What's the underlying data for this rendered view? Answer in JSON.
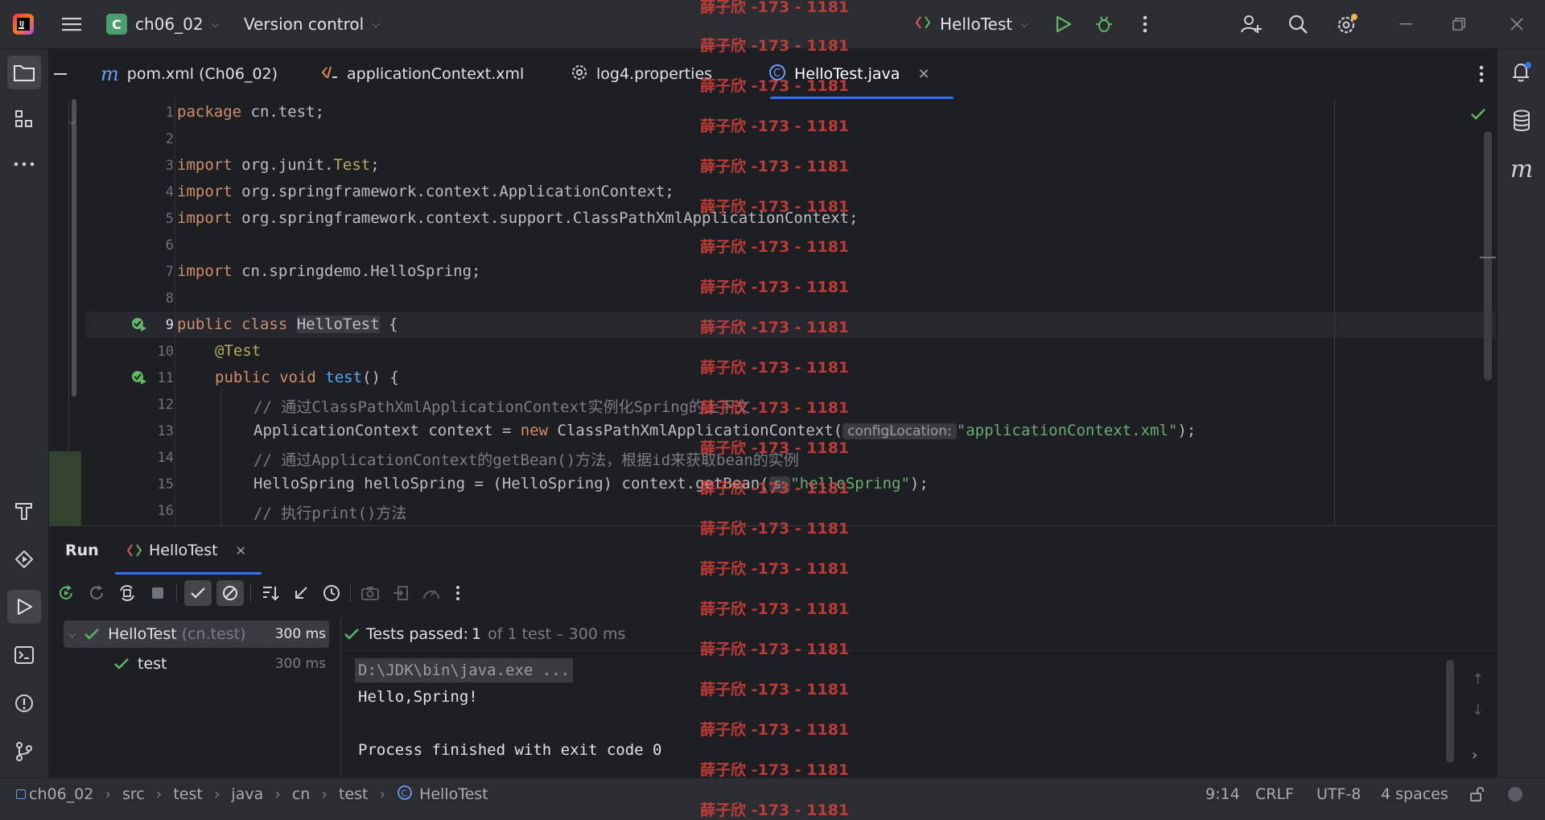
{
  "titlebar": {
    "project_badge": "C",
    "project_name": "ch06_02",
    "version_control": "Version control",
    "run_config": "HelloTest"
  },
  "tabs": [
    {
      "label": "pom.xml (Ch06_02)"
    },
    {
      "label": "applicationContext.xml"
    },
    {
      "label": "log4.properties"
    },
    {
      "label": "HelloTest.java"
    }
  ],
  "editor": {
    "lines": [
      {
        "n": "1"
      },
      {
        "n": "2"
      },
      {
        "n": "3"
      },
      {
        "n": "4"
      },
      {
        "n": "5"
      },
      {
        "n": "6"
      },
      {
        "n": "7"
      },
      {
        "n": "8"
      },
      {
        "n": "9"
      },
      {
        "n": "10"
      },
      {
        "n": "11"
      },
      {
        "n": "12"
      },
      {
        "n": "13"
      },
      {
        "n": "14"
      },
      {
        "n": "15"
      },
      {
        "n": "16"
      }
    ],
    "code": {
      "l1a": "package",
      "l1b": " cn.test;",
      "l3a": "import",
      "l3b": " org.junit.",
      "l3c": "Test",
      "l3d": ";",
      "l4a": "import",
      "l4b": " org.springframework.context.ApplicationContext;",
      "l5a": "import",
      "l5b": " org.springframework.context.support.ClassPathXmlApplicationContext;",
      "l7a": "import",
      "l7b": " cn.springdemo.HelloSpring;",
      "l9a": "public class",
      "l9b": "HelloTest",
      "l9c": " {",
      "l10": "@Test",
      "l11a": "public void",
      "l11b": "test",
      "l11c": "() {",
      "l12": "// 通过ClassPathXmlApplicationContext实例化Spring的上下文",
      "l13a": "ApplicationContext context = ",
      "l13b": "new",
      "l13c": " ClassPathXmlApplicationContext(",
      "l13hint": "configLocation:",
      "l13str": "\"applicationContext.xml\"",
      "l13d": ");",
      "l14": "// 通过ApplicationContext的getBean()方法，根据id来获取bean的实例",
      "l15a": "HelloSpring helloSpring = (HelloSpring) context.getBean(",
      "l15hint": "s:",
      "l15str": "\"helloSpring\"",
      "l15b": ");",
      "l16": "// 执行print()方法"
    }
  },
  "run": {
    "title": "Run",
    "tab": "HelloTest",
    "tree": [
      {
        "name": "HelloTest",
        "pkg": "(cn.test)",
        "time": "300 ms"
      },
      {
        "name": "test",
        "time": "300 ms"
      }
    ],
    "summary_passed": "Tests passed:",
    "summary_count": "1",
    "summary_rest": "of 1 test – 300 ms",
    "console": [
      "D:\\JDK\\bin\\java.exe ...",
      "Hello,Spring!",
      "",
      "Process finished with exit code 0"
    ]
  },
  "statusbar": {
    "breadcrumbs": [
      "ch06_02",
      "src",
      "test",
      "java",
      "cn",
      "test",
      "HelloTest"
    ],
    "position": "9:14",
    "line_sep": "CRLF",
    "encoding": "UTF-8",
    "indent": "4 spaces"
  },
  "watermark": "薛子欣 -173 - 1181",
  "colors": {
    "accent": "#3574f0",
    "pass": "#5fb865",
    "run": "#5fb865",
    "watermark": "#d8403c"
  }
}
